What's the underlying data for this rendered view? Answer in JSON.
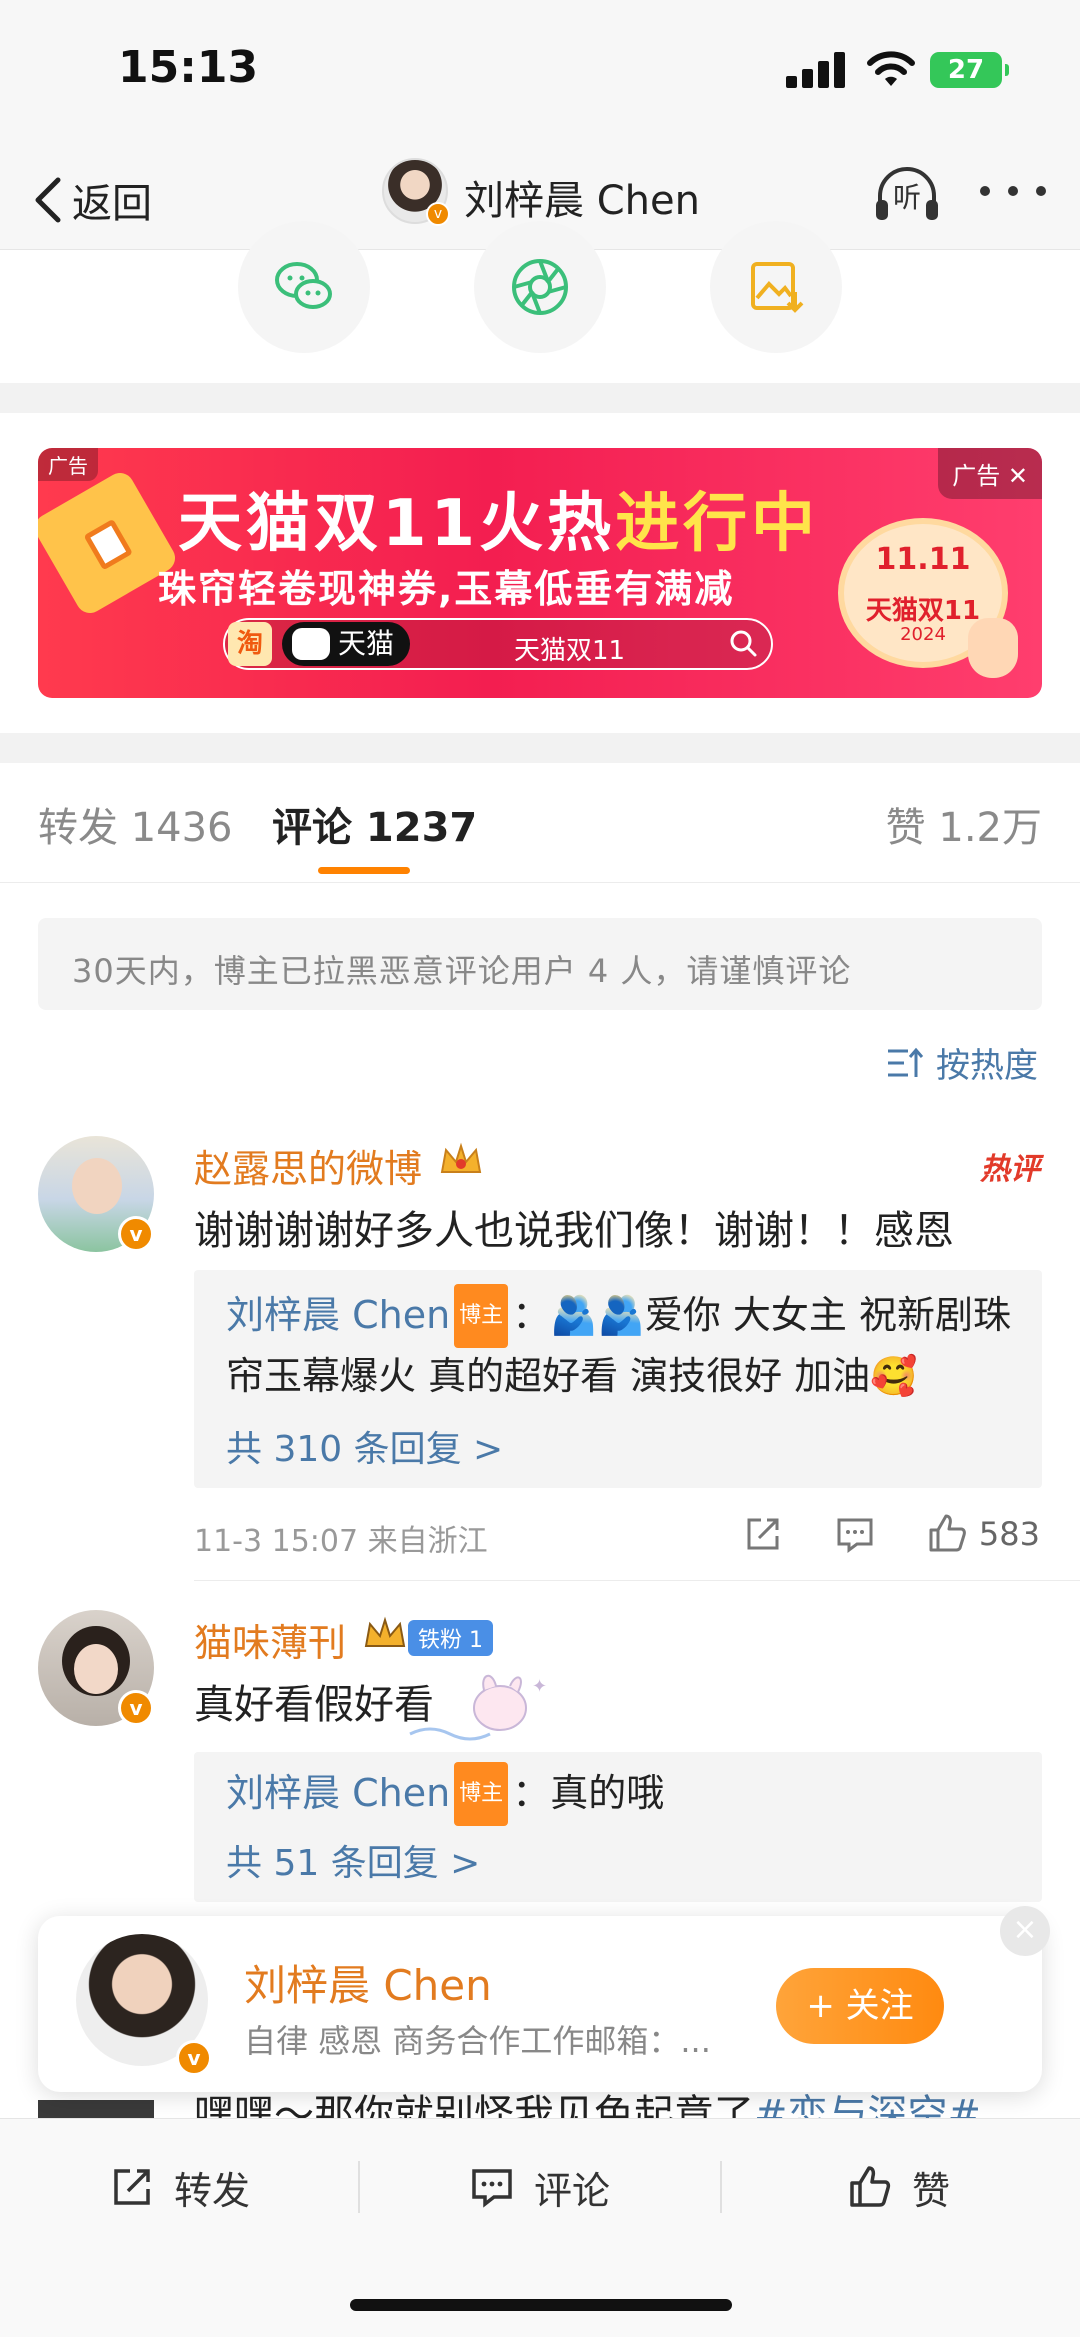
{
  "status_bar": {
    "time": "15:13",
    "battery": "27"
  },
  "nav": {
    "back_label": "返回",
    "title": "刘梓晨 Chen",
    "listen_label": "听"
  },
  "share_icons": [
    "wechat-icon",
    "moments-icon",
    "save-image-icon"
  ],
  "ad": {
    "small_tag": "广告",
    "close_tag": "广告 ✕",
    "headline_a": "天猫双11火热",
    "headline_b": "进行中",
    "subline": "珠帘轻卷现神券,玉幕低垂有满减",
    "taobao_logo": "淘",
    "tmall_label": "天猫",
    "search_text": "天猫双11",
    "seal_top": "11.11",
    "seal_mid": "天猫双11",
    "seal_bottom": "2024",
    "colors": {
      "banner": "#f31e50",
      "highlight": "#ffe44a"
    }
  },
  "tabs": {
    "repost": "转发 1436",
    "comments": "评论 1237",
    "likes": "赞 1.2万"
  },
  "notice": "30天内，博主已拉黑恶意评论用户 4 人，请谨慎评论",
  "sort_label": "按热度",
  "comments": [
    {
      "name": "赵露思的微博",
      "hot_label": "热评",
      "text": "谢谢谢谢好多人也说我们像！谢谢！！感恩",
      "reply_author": "刘梓晨 Chen",
      "host_tag": "博主",
      "reply_text_line1": "：🫂🫂爱你 大女主 祝新剧珠",
      "reply_text_line2": "帘玉幕爆火 真的超好看 演技很好 加油🥰",
      "reply_more": "共 310 条回复 >",
      "time_location": "11-3 15:07 来自浙江",
      "like_count": "583"
    },
    {
      "name": "猫味薄刊",
      "fan_tag": "铁粉 1",
      "text": "真好看假好看",
      "reply_author": "刘梓晨 Chen",
      "host_tag": "博主",
      "reply_text": "：真的哦",
      "reply_more": "共 51 条回复 >"
    }
  ],
  "follow_card": {
    "name": "刘梓晨 Chen",
    "desc": "自律 感恩  商务合作工作邮箱：...",
    "button": "+ 关注",
    "close": "×"
  },
  "peek_comment": {
    "text": "嘿嘿～那你就别怪我见色起意了",
    "topic": "#恋与深空#"
  },
  "toolbar": {
    "repost": "转发",
    "comment": "评论",
    "like": "赞"
  }
}
